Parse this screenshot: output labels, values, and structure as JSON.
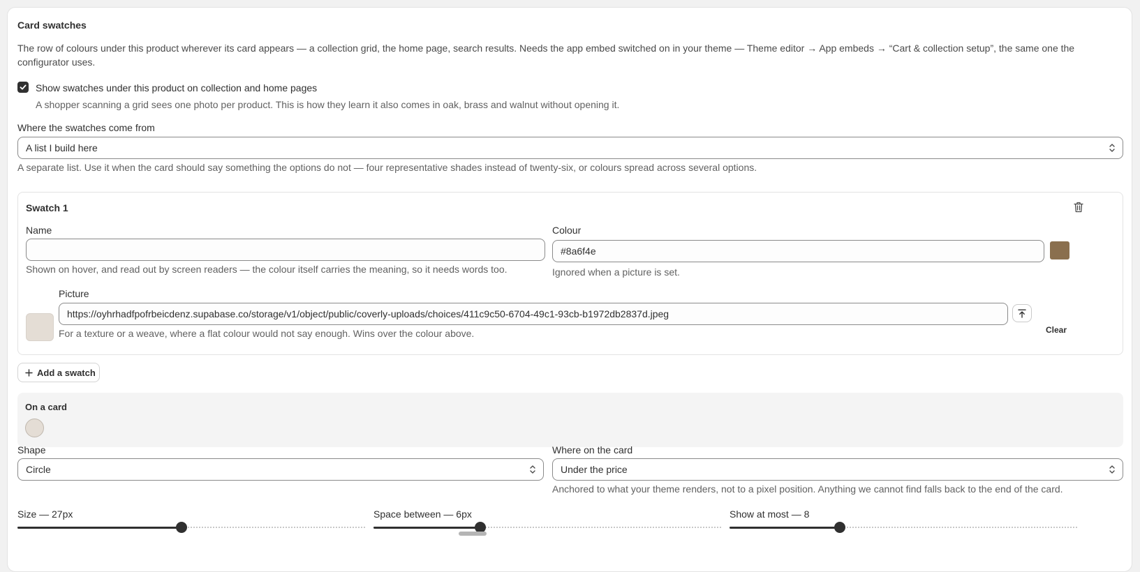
{
  "section": {
    "title": "Card swatches",
    "description": "The row of colours under this product wherever its card appears — a collection grid, the home page, search results. Needs the app embed switched on in your theme — Theme editor → App embeds → “Cart & collection setup”, the same one the configurator uses."
  },
  "show_swatches": {
    "checked": true,
    "label": "Show swatches under this product on collection and home pages",
    "help": "A shopper scanning a grid sees one photo per product. This is how they learn it also comes in oak, brass and walnut without opening it."
  },
  "source": {
    "label": "Where the swatches come from",
    "value": "A list I build here",
    "help": "A separate list. Use it when the card should say something the options do not — four representative shades instead of twenty-six, or colours spread across several options."
  },
  "swatch": {
    "title": "Swatch 1",
    "name_label": "Name",
    "name_value": "",
    "name_help": "Shown on hover, and read out by screen readers — the colour itself carries the meaning, so it needs words too.",
    "colour_label": "Colour",
    "colour_value": "#8a6f4e",
    "colour_help": "Ignored when a picture is set.",
    "picture_label": "Picture",
    "picture_value": "https://oyhrhadfpofrbeicdenz.supabase.co/storage/v1/object/public/coverly-uploads/choices/411c9c50-6704-49c1-93cb-b1972db2837d.jpeg",
    "picture_help": "For a texture or a weave, where a flat colour would not say enough. Wins over the colour above.",
    "clear_label": "Clear",
    "thumb_color": "#e4ddd5"
  },
  "add_swatch_label": "Add a swatch",
  "preview": {
    "title": "On a card",
    "dot_color": "#e4ddd5"
  },
  "shape": {
    "label": "Shape",
    "value": "Circle"
  },
  "position": {
    "label": "Where on the card",
    "value": "Under the price",
    "help": "Anchored to what your theme renders, not to a pixel position. Anything we cannot find falls back to the end of the card."
  },
  "sliders": {
    "size": {
      "label": "Size — 27px",
      "fraction": 0.47
    },
    "space": {
      "label": "Space between — 6px",
      "fraction": 0.3
    },
    "max": {
      "label": "Show at most — 8",
      "fraction": 0.31
    }
  },
  "colors": {
    "accent": "#303030",
    "swatch_brown": "#8a6f4e"
  }
}
